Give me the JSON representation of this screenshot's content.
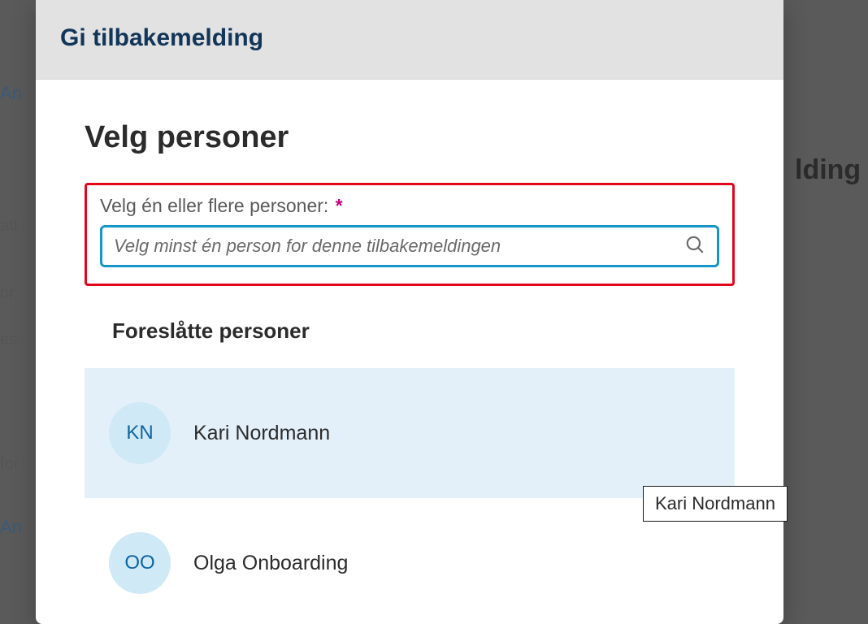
{
  "background": {
    "frag1": "An",
    "frag2": "att",
    "frag3": "br",
    "frag4": "es.",
    "frag5": "for",
    "frag6": "An",
    "title_frag": "lding"
  },
  "modal": {
    "title": "Gi tilbakemelding",
    "section_title": "Velg personer",
    "field_label": "Velg én eller flere personer:",
    "required_marker": "*",
    "search_placeholder": "Velg minst én person for denne tilbakemeldingen",
    "suggested_heading": "Foreslåtte personer",
    "icons": {
      "search": "search-icon"
    },
    "people": [
      {
        "initials": "KN",
        "name": "Kari Nordmann",
        "hovered": true
      },
      {
        "initials": "OO",
        "name": "Olga Onboarding",
        "hovered": false
      }
    ]
  },
  "tooltip": {
    "text": "Kari Nordmann"
  }
}
